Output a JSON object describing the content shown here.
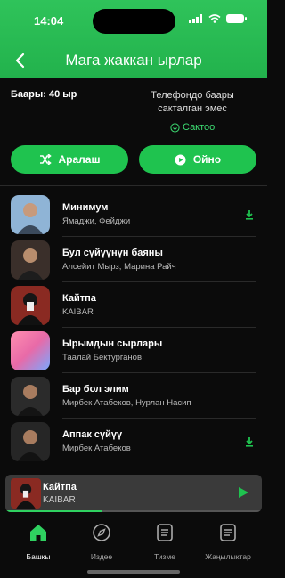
{
  "status_bar": {
    "time": "14:04"
  },
  "header": {
    "title": "Мага жаккан ырлар"
  },
  "summary": {
    "total_label": "Баары: 40 ыр",
    "saved_note": "Телефондо баары сакталган эмес",
    "save_label": "Сактоо"
  },
  "actions": {
    "shuffle_label": "Аралаш",
    "play_label": "Ойно"
  },
  "accent_color": "#1fc34f",
  "songs": [
    {
      "title": "Минимум",
      "artist": "Ямаджи, Фейджи",
      "downloaded": true
    },
    {
      "title": "Бул сүйүүнүн баяны",
      "artist": "Алсейит Мырз, Марина Райч",
      "downloaded": false
    },
    {
      "title": "Кайтпа",
      "artist": "KAIBAR",
      "downloaded": false
    },
    {
      "title": "Ырымдын сырлары",
      "artist": "Таалай Бектурганов",
      "downloaded": false
    },
    {
      "title": "Бар бол элим",
      "artist": "Мирбек Атабеков, Нурлан Насип",
      "downloaded": false
    },
    {
      "title": "Аппак сүйүү",
      "artist": "Мирбек Атабеков",
      "downloaded": true
    }
  ],
  "now_playing": {
    "title": "Кайтпа",
    "artist": "KAIBAR",
    "progress": 0.38
  },
  "tabs": [
    {
      "label": "Башкы",
      "icon": "home-icon",
      "active": true
    },
    {
      "label": "Издөө",
      "icon": "compass-icon",
      "active": false
    },
    {
      "label": "Тизме",
      "icon": "list-icon",
      "active": false
    },
    {
      "label": "Жаңылыктар",
      "icon": "news-icon",
      "active": false
    }
  ]
}
